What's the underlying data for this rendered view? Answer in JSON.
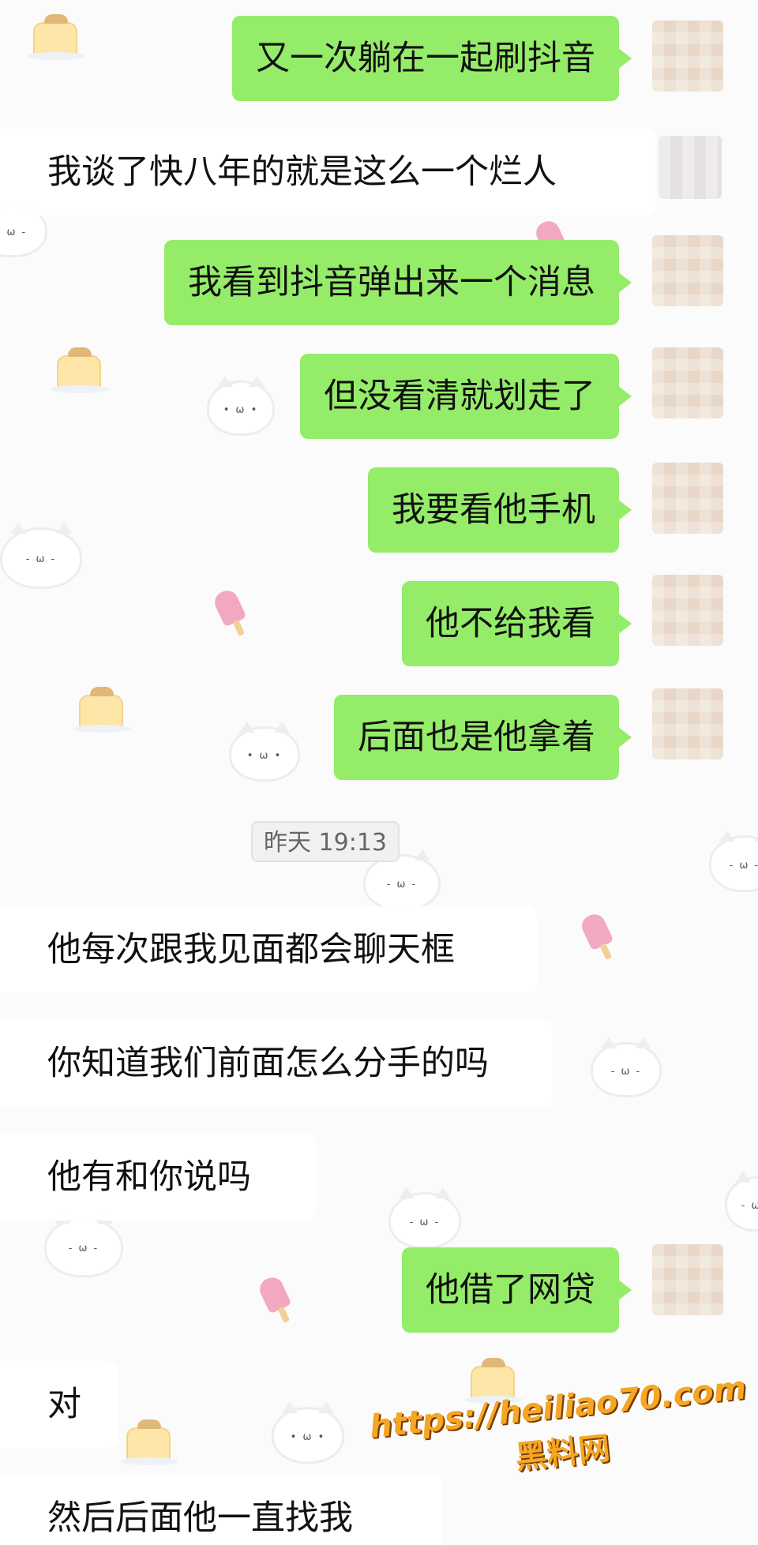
{
  "messages": [
    {
      "side": "right",
      "text": "又一次躺在一起刷抖音"
    },
    {
      "side": "left",
      "text": "我谈了快八年的就是这么一个烂人"
    },
    {
      "side": "right",
      "text": "我看到抖音弹出来一个消息"
    },
    {
      "side": "right",
      "text": "但没看清就划走了"
    },
    {
      "side": "right",
      "text": "我要看他手机"
    },
    {
      "side": "right",
      "text": "他不给我看"
    },
    {
      "side": "right",
      "text": "后面也是他拿着"
    },
    {
      "side": "left",
      "text": "他每次跟我见面都会聊天框"
    },
    {
      "side": "left",
      "text": "你知道我们前面怎么分手的吗"
    },
    {
      "side": "left",
      "text": "他有和你说吗"
    },
    {
      "side": "right",
      "text": "他借了网贷"
    },
    {
      "side": "left",
      "text": "对"
    },
    {
      "side": "left",
      "text": "然后后面他一直找我"
    }
  ],
  "timestamp": "昨天 19:13",
  "watermark": {
    "url": "https://heiliao70.com",
    "name": "黑料网"
  },
  "colors": {
    "sent_bubble": "#95ec69",
    "received_bubble": "#ffffff",
    "background": "#fbfbfb",
    "watermark": "#f5a623"
  },
  "icons": [
    "cat-sticker-icon",
    "pudding-sticker-icon",
    "popsicle-sticker-icon",
    "blurred-avatar"
  ]
}
